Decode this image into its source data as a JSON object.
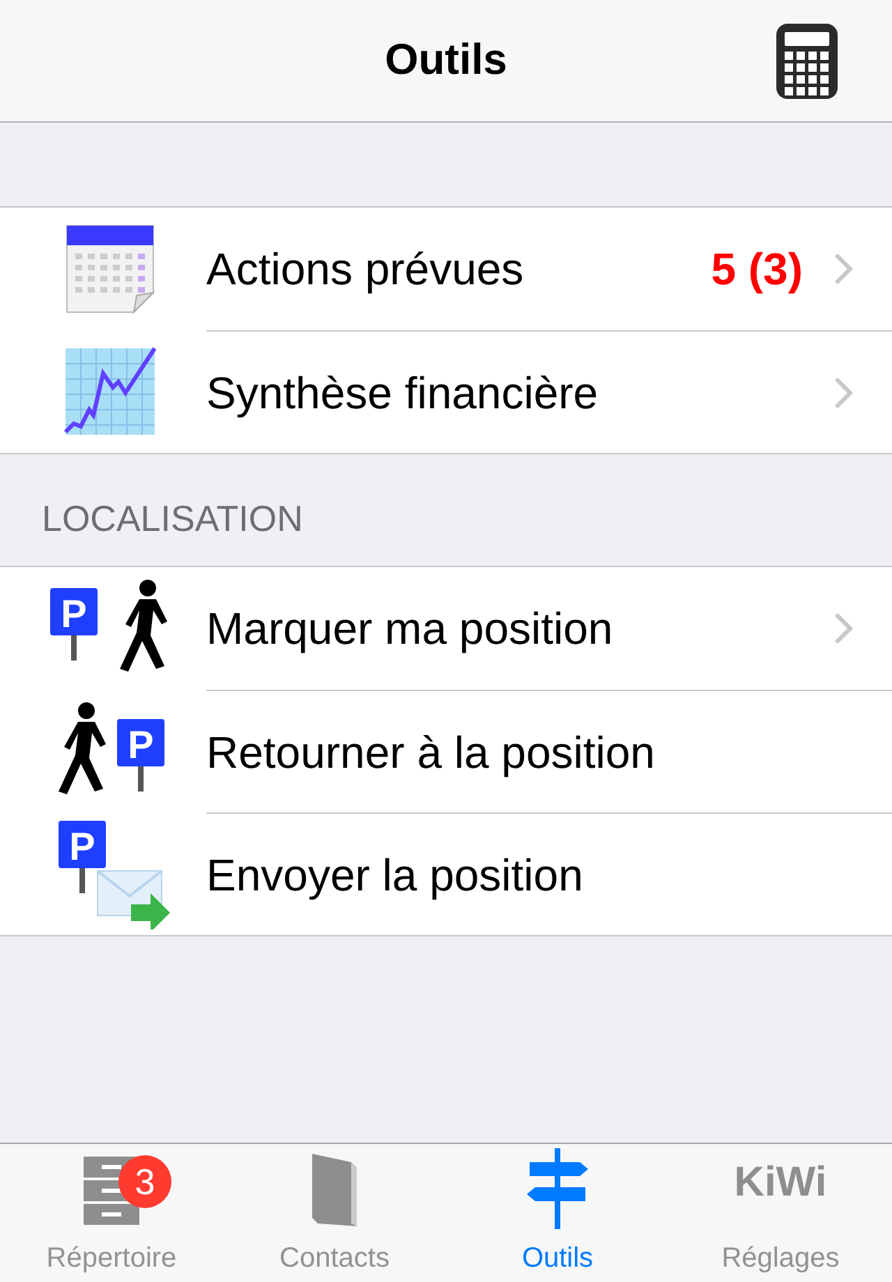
{
  "nav_bar": {
    "title": "Outils"
  },
  "sections": [
    {
      "rows": [
        {
          "kind": "calendar",
          "label": "Actions prévues",
          "detail": "5 (3)",
          "disclosure": true
        },
        {
          "kind": "chart",
          "label": "Synthèse financière",
          "disclosure": true
        }
      ]
    },
    {
      "header": "LOCALISATION",
      "rows": [
        {
          "kind": "park-walk",
          "sign_text": "P",
          "label": "Marquer ma position",
          "disclosure": true
        },
        {
          "kind": "walk-park",
          "sign_text": "P",
          "label": "Retourner à la position",
          "disclosure": false
        },
        {
          "kind": "park-mail",
          "sign_text": "P",
          "label": "Envoyer la position",
          "disclosure": false
        }
      ]
    }
  ],
  "tab_bar": [
    {
      "kind": "cabinet",
      "label": "Répertoire",
      "badge": "3",
      "selected": false
    },
    {
      "kind": "book",
      "label": "Contacts",
      "selected": false
    },
    {
      "kind": "signpost",
      "label": "Outils",
      "selected": true
    },
    {
      "kind": "logo",
      "icon_text": "KiWi",
      "label": "Réglages",
      "selected": false
    }
  ]
}
